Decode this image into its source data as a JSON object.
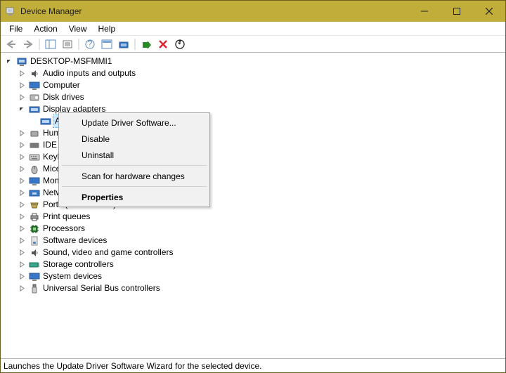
{
  "window": {
    "title": "Device Manager"
  },
  "menu": {
    "file": "File",
    "action": "Action",
    "view": "View",
    "help": "Help"
  },
  "tree": {
    "root": "DESKTOP-MSFMMI1",
    "items": [
      "Audio inputs and outputs",
      "Computer",
      "Disk drives",
      "Display adapters",
      "A",
      "Human",
      "IDE A",
      "Keyb",
      "Mice",
      "Mon",
      "Netw",
      "Ports (COM & LPT)",
      "Print queues",
      "Processors",
      "Software devices",
      "Sound, video and game controllers",
      "Storage controllers",
      "System devices",
      "Universal Serial Bus controllers"
    ]
  },
  "context_menu": {
    "update": "Update Driver Software...",
    "disable": "Disable",
    "uninstall": "Uninstall",
    "scan": "Scan for hardware changes",
    "properties": "Properties"
  },
  "status": "Launches the Update Driver Software Wizard for the selected device."
}
